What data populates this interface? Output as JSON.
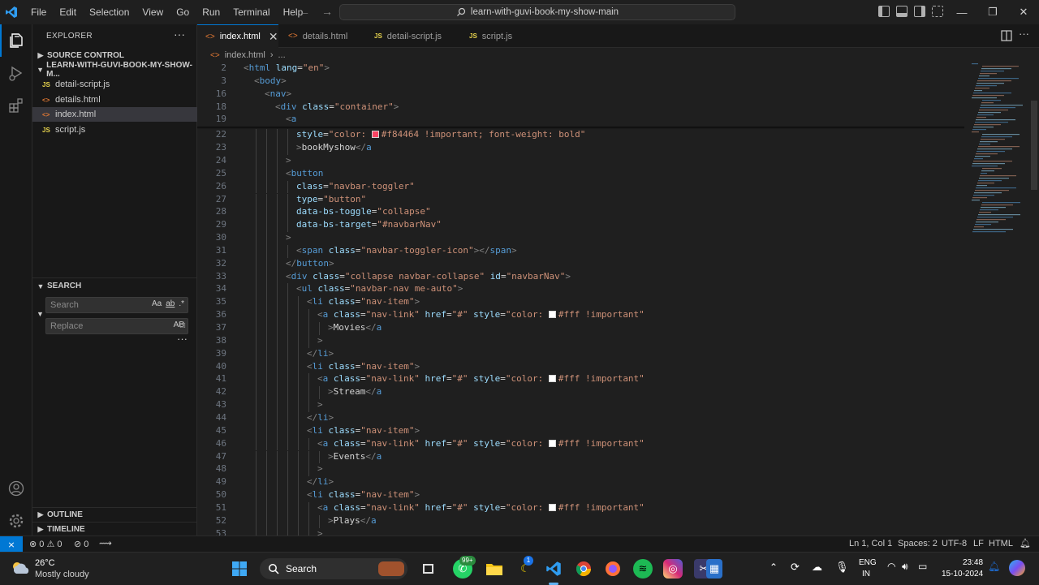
{
  "titlebar": {
    "menu": [
      "File",
      "Edit",
      "Selection",
      "View",
      "Go",
      "Run",
      "Terminal",
      "Help"
    ],
    "search": "learn-with-guvi-book-my-show-main",
    "controls": {
      "minimize": "—",
      "restore": "❐",
      "close": "✕"
    }
  },
  "sidebar": {
    "title": "EXPLORER",
    "more": "···",
    "source_control": "SOURCE CONTROL",
    "project": "LEARN-WITH-GUVI-BOOK-MY-SHOW-M...",
    "files": [
      {
        "name": "detail-script.js",
        "icon": "JS",
        "color": "#e8d44d"
      },
      {
        "name": "details.html",
        "icon": "<>",
        "color": "#e37933"
      },
      {
        "name": "index.html",
        "icon": "<>",
        "color": "#e37933"
      },
      {
        "name": "script.js",
        "icon": "JS",
        "color": "#e8d44d"
      }
    ],
    "search_section": "SEARCH",
    "search_placeholder": "Search",
    "replace_placeholder": "Replace",
    "search_opts": [
      "Aa",
      "ab",
      ".*"
    ],
    "replace_opt": "AB",
    "outline": "OUTLINE",
    "timeline": "TIMELINE"
  },
  "tabs": [
    {
      "label": "index.html",
      "icon": "<>",
      "color": "#e37933"
    },
    {
      "label": "details.html",
      "icon": "<>",
      "color": "#e37933"
    },
    {
      "label": "detail-script.js",
      "icon": "JS",
      "color": "#e8d44d"
    },
    {
      "label": "script.js",
      "icon": "JS",
      "color": "#e8d44d"
    }
  ],
  "breadcrumb": {
    "file": "index.html",
    "rest": "..."
  },
  "editor": {
    "lines": [
      {
        "n": "2",
        "html": "<span class='p'>&lt;</span><span class='t'>html</span> <span class='a'>lang</span><span class='w'>=</span><span class='s'>\"en\"</span><span class='p'>&gt;</span>",
        "indent": 0
      },
      {
        "n": "3",
        "html": "<span class='p'>&lt;</span><span class='t'>body</span><span class='p'>&gt;</span>",
        "indent": 1
      },
      {
        "n": "16",
        "html": "<span class='p'>&lt;</span><span class='t'>nav</span><span class='p'>&gt;</span>",
        "indent": 2
      },
      {
        "n": "18",
        "html": "<span class='p'>&lt;</span><span class='t'>div</span> <span class='a'>class</span><span class='w'>=</span><span class='s'>\"container\"</span><span class='p'>&gt;</span>",
        "indent": 3
      },
      {
        "n": "19",
        "html": "<span class='p'>&lt;</span><span class='t'>a</span>",
        "indent": 4
      },
      {
        "n": "22",
        "html": "<span class='a'>style</span><span class='w'>=</span><span class='s'>\"color: <span class='swatch' style='background:#f84464'></span>#f84464 !important; font-weight: bold\"</span>",
        "indent": 5
      },
      {
        "n": "23",
        "html": "<span class='p'>&gt;</span><span class='w'>bookMyshow</span><span class='p'>&lt;/</span><span class='t'>a</span>",
        "indent": 5
      },
      {
        "n": "24",
        "html": "<span class='p'>&gt;</span>",
        "indent": 4
      },
      {
        "n": "25",
        "html": "<span class='p'>&lt;</span><span class='t'>button</span>",
        "indent": 4
      },
      {
        "n": "26",
        "html": "<span class='a'>class</span><span class='w'>=</span><span class='s'>\"navbar-toggler\"</span>",
        "indent": 5
      },
      {
        "n": "27",
        "html": "<span class='a'>type</span><span class='w'>=</span><span class='s'>\"button\"</span>",
        "indent": 5
      },
      {
        "n": "28",
        "html": "<span class='a'>data-bs-toggle</span><span class='w'>=</span><span class='s'>\"collapse\"</span>",
        "indent": 5
      },
      {
        "n": "29",
        "html": "<span class='a'>data-bs-target</span><span class='w'>=</span><span class='s'>\"#navbarNav\"</span>",
        "indent": 5
      },
      {
        "n": "30",
        "html": "<span class='p'>&gt;</span>",
        "indent": 4
      },
      {
        "n": "31",
        "html": "<span class='p'>&lt;</span><span class='t'>span</span> <span class='a'>class</span><span class='w'>=</span><span class='s'>\"navbar-toggler-icon\"</span><span class='p'>&gt;&lt;/</span><span class='t'>span</span><span class='p'>&gt;</span>",
        "indent": 5
      },
      {
        "n": "32",
        "html": "<span class='p'>&lt;/</span><span class='t'>button</span><span class='p'>&gt;</span>",
        "indent": 4
      },
      {
        "n": "33",
        "html": "<span class='p'>&lt;</span><span class='t'>div</span> <span class='a'>class</span><span class='w'>=</span><span class='s'>\"collapse navbar-collapse\"</span> <span class='a'>id</span><span class='w'>=</span><span class='s'>\"navbarNav\"</span><span class='p'>&gt;</span>",
        "indent": 4
      },
      {
        "n": "34",
        "html": "<span class='p'>&lt;</span><span class='t'>ul</span> <span class='a'>class</span><span class='w'>=</span><span class='s'>\"navbar-nav me-auto\"</span><span class='p'>&gt;</span>",
        "indent": 5
      },
      {
        "n": "35",
        "html": "<span class='p'>&lt;</span><span class='t'>li</span> <span class='a'>class</span><span class='w'>=</span><span class='s'>\"nav-item\"</span><span class='p'>&gt;</span>",
        "indent": 6
      },
      {
        "n": "36",
        "html": "<span class='p'>&lt;</span><span class='t'>a</span> <span class='a'>class</span><span class='w'>=</span><span class='s'>\"nav-link\"</span> <span class='a'>href</span><span class='w'>=</span><span class='s'>\"#\"</span> <span class='a'>style</span><span class='w'>=</span><span class='s'>\"color: <span class='swatch' style='background:#ffffff'></span>#fff !important\"</span>",
        "indent": 7
      },
      {
        "n": "37",
        "html": "<span class='p'>&gt;</span><span class='w'>Movies</span><span class='p'>&lt;/</span><span class='t'>a</span>",
        "indent": 8
      },
      {
        "n": "38",
        "html": "<span class='p'>&gt;</span>",
        "indent": 7
      },
      {
        "n": "39",
        "html": "<span class='p'>&lt;/</span><span class='t'>li</span><span class='p'>&gt;</span>",
        "indent": 6
      },
      {
        "n": "40",
        "html": "<span class='p'>&lt;</span><span class='t'>li</span> <span class='a'>class</span><span class='w'>=</span><span class='s'>\"nav-item\"</span><span class='p'>&gt;</span>",
        "indent": 6
      },
      {
        "n": "41",
        "html": "<span class='p'>&lt;</span><span class='t'>a</span> <span class='a'>class</span><span class='w'>=</span><span class='s'>\"nav-link\"</span> <span class='a'>href</span><span class='w'>=</span><span class='s'>\"#\"</span> <span class='a'>style</span><span class='w'>=</span><span class='s'>\"color: <span class='swatch' style='background:#ffffff'></span>#fff !important\"</span>",
        "indent": 7
      },
      {
        "n": "42",
        "html": "<span class='p'>&gt;</span><span class='w'>Stream</span><span class='p'>&lt;/</span><span class='t'>a</span>",
        "indent": 8
      },
      {
        "n": "43",
        "html": "<span class='p'>&gt;</span>",
        "indent": 7
      },
      {
        "n": "44",
        "html": "<span class='p'>&lt;/</span><span class='t'>li</span><span class='p'>&gt;</span>",
        "indent": 6
      },
      {
        "n": "45",
        "html": "<span class='p'>&lt;</span><span class='t'>li</span> <span class='a'>class</span><span class='w'>=</span><span class='s'>\"nav-item\"</span><span class='p'>&gt;</span>",
        "indent": 6
      },
      {
        "n": "46",
        "html": "<span class='p'>&lt;</span><span class='t'>a</span> <span class='a'>class</span><span class='w'>=</span><span class='s'>\"nav-link\"</span> <span class='a'>href</span><span class='w'>=</span><span class='s'>\"#\"</span> <span class='a'>style</span><span class='w'>=</span><span class='s'>\"color: <span class='swatch' style='background:#ffffff'></span>#fff !important\"</span>",
        "indent": 7
      },
      {
        "n": "47",
        "html": "<span class='p'>&gt;</span><span class='w'>Events</span><span class='p'>&lt;/</span><span class='t'>a</span>",
        "indent": 8
      },
      {
        "n": "48",
        "html": "<span class='p'>&gt;</span>",
        "indent": 7
      },
      {
        "n": "49",
        "html": "<span class='p'>&lt;/</span><span class='t'>li</span><span class='p'>&gt;</span>",
        "indent": 6
      },
      {
        "n": "50",
        "html": "<span class='p'>&lt;</span><span class='t'>li</span> <span class='a'>class</span><span class='w'>=</span><span class='s'>\"nav-item\"</span><span class='p'>&gt;</span>",
        "indent": 6
      },
      {
        "n": "51",
        "html": "<span class='p'>&lt;</span><span class='t'>a</span> <span class='a'>class</span><span class='w'>=</span><span class='s'>\"nav-link\"</span> <span class='a'>href</span><span class='w'>=</span><span class='s'>\"#\"</span> <span class='a'>style</span><span class='w'>=</span><span class='s'>\"color: <span class='swatch' style='background:#ffffff'></span>#fff !important\"</span>",
        "indent": 7
      },
      {
        "n": "52",
        "html": "<span class='p'>&gt;</span><span class='w'>Plays</span><span class='p'>&lt;/</span><span class='t'>a</span>",
        "indent": 8
      },
      {
        "n": "53",
        "html": "<span class='p'>&gt;</span>",
        "indent": 7
      }
    ]
  },
  "statusbar": {
    "problems": "⊗ 0 ⚠ 0",
    "ports": "⊘ 0",
    "position": "Ln 1, Col 1",
    "spaces": "Spaces: 2",
    "encoding": "UTF-8",
    "eol": "LF",
    "language": "HTML"
  },
  "taskbar": {
    "weather_temp": "26°C",
    "weather_desc": "Mostly cloudy",
    "search": "Search",
    "whatsapp_badge": "99+",
    "messenger_badge": "1",
    "lang1": "ENG",
    "lang2": "IN",
    "time": "23:48",
    "date": "15-10-2024"
  },
  "colors": {
    "accent": "#0078d4",
    "brand_swatch": "#f84464"
  }
}
